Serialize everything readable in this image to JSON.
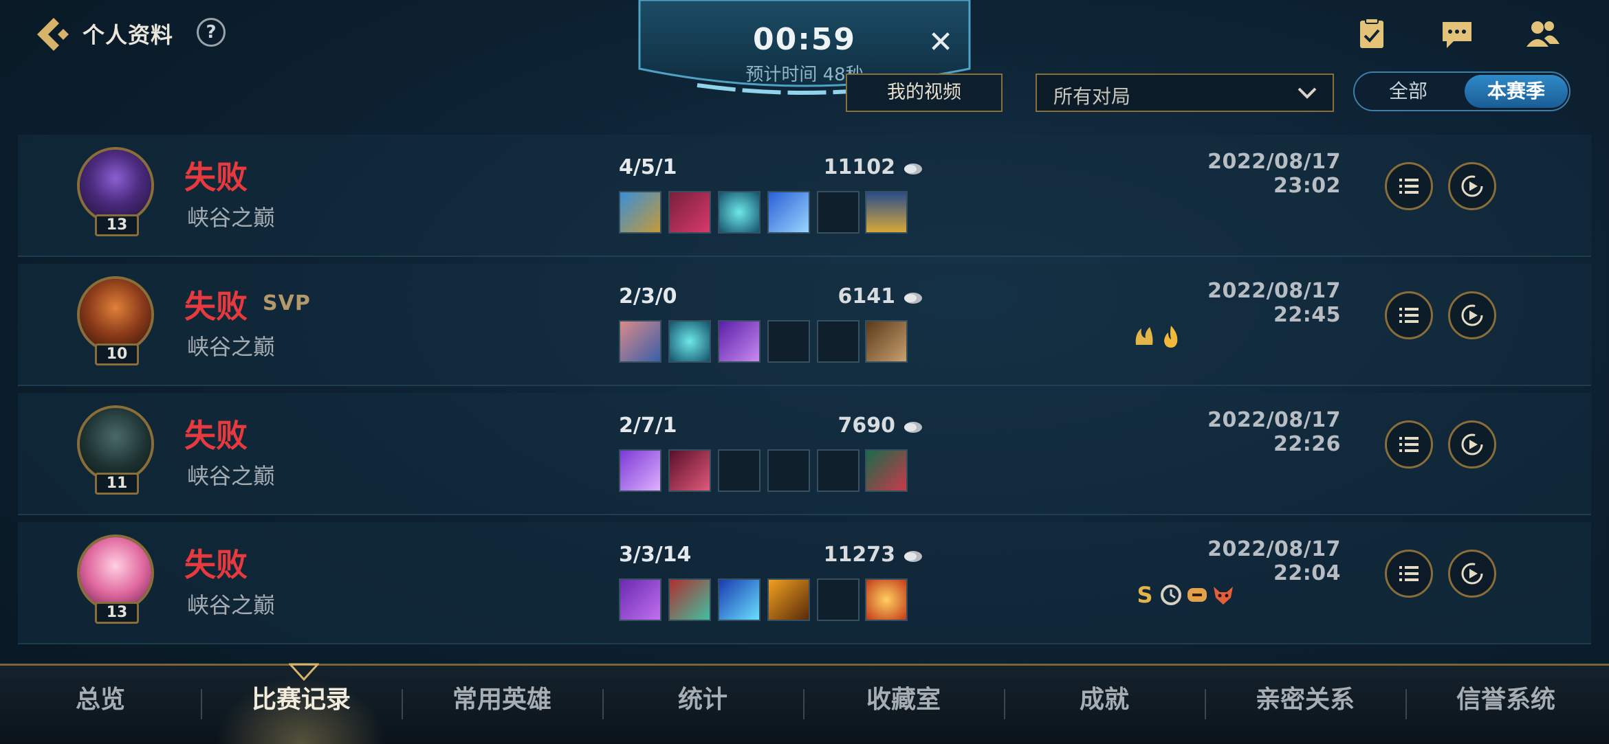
{
  "header": {
    "title": "个人资料",
    "help_label": "?"
  },
  "queue": {
    "time": "00:59",
    "estimated": "预计时间 48秒",
    "close_label": "✕"
  },
  "filters": {
    "my_videos": "我的视频",
    "match_type": "所有对局",
    "toggle_all": "全部",
    "toggle_season": "本赛季"
  },
  "matches": [
    {
      "result": "失败",
      "svp": "",
      "mode": "峡谷之巅",
      "level": "13",
      "kda": "4/5/1",
      "gold": "11102",
      "date": "2022/08/17 23:02"
    },
    {
      "result": "失败",
      "svp": "SVP",
      "mode": "峡谷之巅",
      "level": "10",
      "kda": "2/3/0",
      "gold": "6141",
      "date": "2022/08/17 22:45"
    },
    {
      "result": "失败",
      "svp": "",
      "mode": "峡谷之巅",
      "level": "11",
      "kda": "2/7/1",
      "gold": "7690",
      "date": "2022/08/17 22:26"
    },
    {
      "result": "失败",
      "svp": "",
      "mode": "峡谷之巅",
      "level": "13",
      "kda": "3/3/14",
      "gold": "11273",
      "date": "2022/08/17 22:04"
    }
  ],
  "badges_row4_s": "S",
  "bottom_nav": [
    "总览",
    "比赛记录",
    "常用英雄",
    "统计",
    "收藏室",
    "成就",
    "亲密关系",
    "信誉系统"
  ],
  "colors": {
    "loss": "#e63a3f",
    "gold_border": "#8a6e3a",
    "accent_blue": "#2f8ac8"
  }
}
